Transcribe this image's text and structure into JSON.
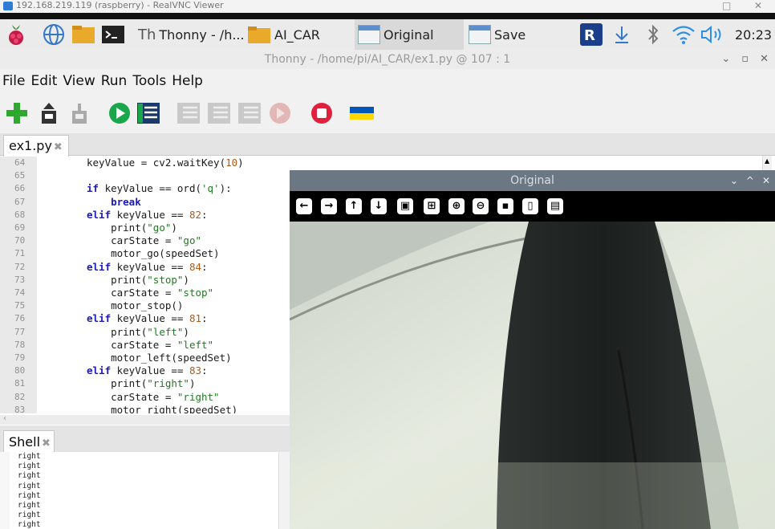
{
  "vnc": {
    "title": "192.168.219.119 (raspberry) - RealVNC Viewer",
    "minimize": "−",
    "close": "✕",
    "restore": "□"
  },
  "taskbar": {
    "thonny_task": "Thonny  -  /h...",
    "folder_task": "AI_CAR",
    "window_original": "Original",
    "window_save": "Save",
    "clock": "20:23"
  },
  "thonny": {
    "title": "Thonny  -  /home/pi/AI_CAR/ex1.py  @  107 : 1",
    "menu": [
      "File",
      "Edit",
      "View",
      "Run",
      "Tools",
      "Help"
    ],
    "editor_tab": "ex1.py",
    "shell_tab": "Shell",
    "tab_close": "✖"
  },
  "code_lines": [
    {
      "n": "64",
      "text": "keyValue = cv2.waitKey(10)"
    },
    {
      "n": "65",
      "text": ""
    },
    {
      "n": "66",
      "text": "if keyValue == ord('q'):"
    },
    {
      "n": "67",
      "text": "    break"
    },
    {
      "n": "68",
      "text": "elif keyValue == 82:"
    },
    {
      "n": "69",
      "text": "    print(\"go\")"
    },
    {
      "n": "70",
      "text": "    carState = \"go\""
    },
    {
      "n": "71",
      "text": "    motor_go(speedSet)"
    },
    {
      "n": "72",
      "text": "elif keyValue == 84:"
    },
    {
      "n": "73",
      "text": "    print(\"stop\")"
    },
    {
      "n": "74",
      "text": "    carState = \"stop\""
    },
    {
      "n": "75",
      "text": "    motor_stop()"
    },
    {
      "n": "76",
      "text": "elif keyValue == 81:"
    },
    {
      "n": "77",
      "text": "    print(\"left\")"
    },
    {
      "n": "78",
      "text": "    carState = \"left\""
    },
    {
      "n": "79",
      "text": "    motor_left(speedSet)"
    },
    {
      "n": "80",
      "text": "elif keyValue == 83:"
    },
    {
      "n": "81",
      "text": "    print(\"right\")"
    },
    {
      "n": "82",
      "text": "    carState = \"right\""
    },
    {
      "n": "83",
      "text": "    motor_right(speedSet)"
    }
  ],
  "shell_output": [
    "right",
    "right",
    "right",
    "right",
    "right",
    "right",
    "right",
    "right"
  ],
  "cv_window": {
    "title": "Original",
    "controls": [
      "⌄",
      "^",
      "✕"
    ]
  },
  "colors": {
    "run_green": "#1aa64a",
    "stop_red": "#e0203c",
    "flag_blue": "#0057b7",
    "flag_yellow": "#ffd700",
    "keyword": "#1a1ab8",
    "string": "#1f7a1f",
    "number": "#b15a16"
  }
}
